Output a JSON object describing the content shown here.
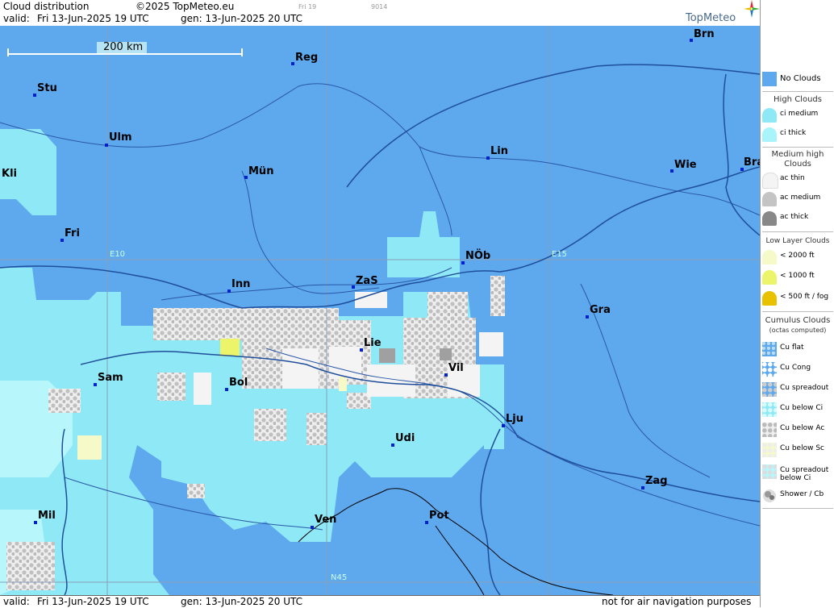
{
  "header": {
    "title": "Cloud distribution",
    "copyright": "©2025 TopMeteo.eu",
    "day_code": "Fri 19",
    "run_code": "9014",
    "valid_label": "valid:",
    "valid": "Fri  13-Jun-2025  19 UTC",
    "gen": "gen: 13-Jun-2025 20 UTC",
    "brand": "TopMeteo"
  },
  "footer": {
    "valid_label": "valid:",
    "valid": "Fri  13-Jun-2025  19 UTC",
    "gen": "gen: 13-Jun-2025 20 UTC",
    "disclaimer": "not for air navigation purposes"
  },
  "scale": {
    "label": "200 km"
  },
  "grid_labels": {
    "e10": "E10",
    "e15": "E15",
    "n45": "N45"
  },
  "cities": [
    {
      "code": "Brn"
    },
    {
      "code": "Reg"
    },
    {
      "code": "Stu"
    },
    {
      "code": "Ulm"
    },
    {
      "code": "Lin"
    },
    {
      "code": "Kli"
    },
    {
      "code": "Mün"
    },
    {
      "code": "Wie"
    },
    {
      "code": "Bra"
    },
    {
      "code": "Fri"
    },
    {
      "code": "NÖb"
    },
    {
      "code": "Inn"
    },
    {
      "code": "ZaS"
    },
    {
      "code": "Gra"
    },
    {
      "code": "Lie"
    },
    {
      "code": "Vil"
    },
    {
      "code": "Sam"
    },
    {
      "code": "Bol"
    },
    {
      "code": "Lju"
    },
    {
      "code": "Udi"
    },
    {
      "code": "Zag"
    },
    {
      "code": "Mil"
    },
    {
      "code": "Pot"
    },
    {
      "code": "Ven"
    }
  ],
  "legend": {
    "no_clouds": "No Clouds",
    "high": {
      "title": "High Clouds",
      "items": [
        "ci medium",
        "ci thick"
      ]
    },
    "medium": {
      "title": "Medium high Clouds",
      "items": [
        "ac thin",
        "ac medium",
        "ac thick"
      ]
    },
    "low": {
      "title": "Low Layer Clouds",
      "items": [
        "< 2000 ft",
        "< 1000 ft",
        "< 500 ft / fog"
      ]
    },
    "cumulus": {
      "title": "Cumulus Clouds",
      "subtitle": "(octas computed)",
      "items": [
        "Cu flat",
        "Cu Cong",
        "Cu spreadout",
        "Cu below Ci",
        "Cu below Ac",
        "Cu below Sc",
        "Cu spreadout below Ci",
        "Shower / Cb"
      ]
    }
  },
  "colors": {
    "no_clouds": "#5ea8ee",
    "ci_medium": "#8fe8f5",
    "ci_thick": "#a8f4fa",
    "ac_thin": "#f4f4f4",
    "ac_medium": "#c4c4c4",
    "ac_thick": "#888888",
    "low_2000": "#f6f9c8",
    "low_1000": "#ecf56a",
    "low_500": "#e8c200",
    "border": "#1f4f9a",
    "grid": "#8aa0b8"
  }
}
